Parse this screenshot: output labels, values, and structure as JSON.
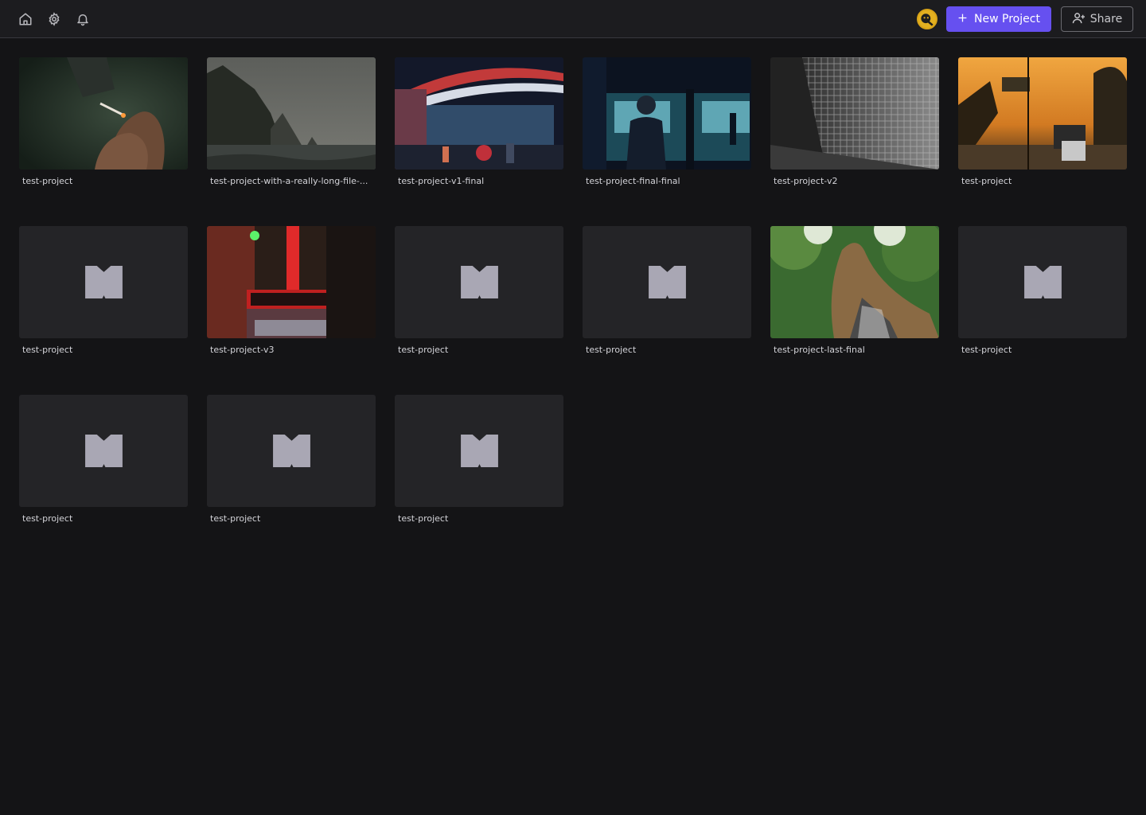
{
  "topbar": {
    "icons": [
      "home-icon",
      "gear-icon",
      "bell-icon"
    ],
    "new_project_label": "New Project",
    "share_label": "Share",
    "accent_color": "#6650f0"
  },
  "projects": [
    {
      "name": "test-project",
      "thumb": "smoking-hand"
    },
    {
      "name": "test-project-with-a-really-long-file-...",
      "thumb": "sea-cliffs"
    },
    {
      "name": "test-project-v1-final",
      "thumb": "neon-diner"
    },
    {
      "name": "test-project-final-final",
      "thumb": "subway-platform"
    },
    {
      "name": "test-project-v2",
      "thumb": "glass-wall"
    },
    {
      "name": "test-project",
      "thumb": "sunset-street"
    },
    {
      "name": "test-project",
      "thumb": "placeholder"
    },
    {
      "name": "test-project-v3",
      "thumb": "neon-theater"
    },
    {
      "name": "test-project",
      "thumb": "placeholder"
    },
    {
      "name": "test-project",
      "thumb": "placeholder"
    },
    {
      "name": "test-project-last-final",
      "thumb": "forest-hair"
    },
    {
      "name": "test-project",
      "thumb": "placeholder"
    },
    {
      "name": "test-project",
      "thumb": "placeholder"
    },
    {
      "name": "test-project",
      "thumb": "placeholder"
    },
    {
      "name": "test-project",
      "thumb": "placeholder"
    }
  ]
}
